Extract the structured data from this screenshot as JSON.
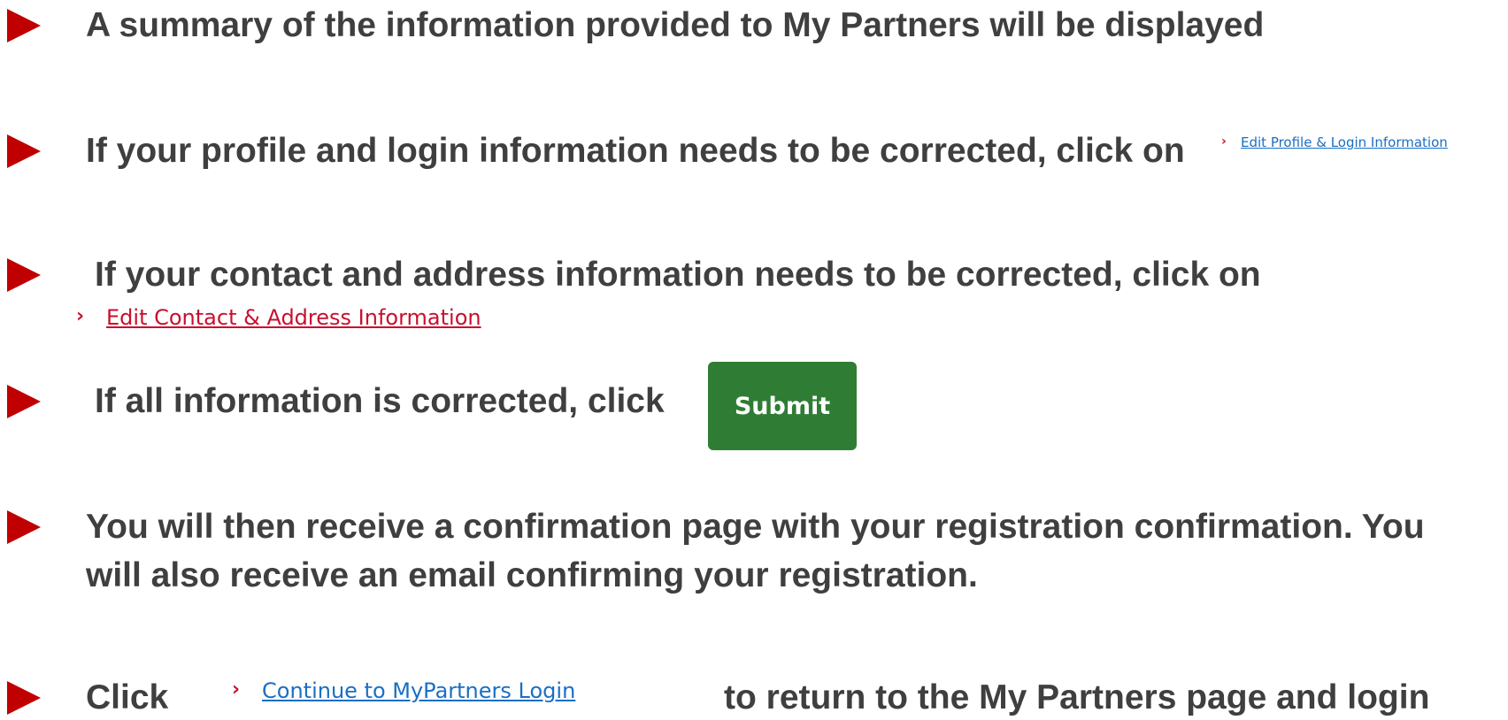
{
  "colors": {
    "bullet": "#c00000",
    "text": "#3f3f3f",
    "link_blue": "#1a6fc4",
    "link_red": "#c8102e",
    "submit_bg": "#2f7d34"
  },
  "steps": [
    {
      "text": "A summary of the information provided to My Partners will be displayed"
    },
    {
      "text": "If your profile and login information needs to be corrected, click on",
      "link": "Edit Profile & Login Information"
    },
    {
      "text": "If your contact and address information needs to be corrected, click on",
      "link": "Edit Contact & Address Information"
    },
    {
      "text": "If all information is corrected, click",
      "button": "Submit"
    },
    {
      "text_line1": "You will then receive a confirmation page with your registration confirmation. You",
      "text_line2": "will also receive an email confirming your registration."
    },
    {
      "text_before": "Click",
      "link": "Continue to MyPartners Login",
      "text_after": "to return to the My Partners page and login"
    }
  ]
}
